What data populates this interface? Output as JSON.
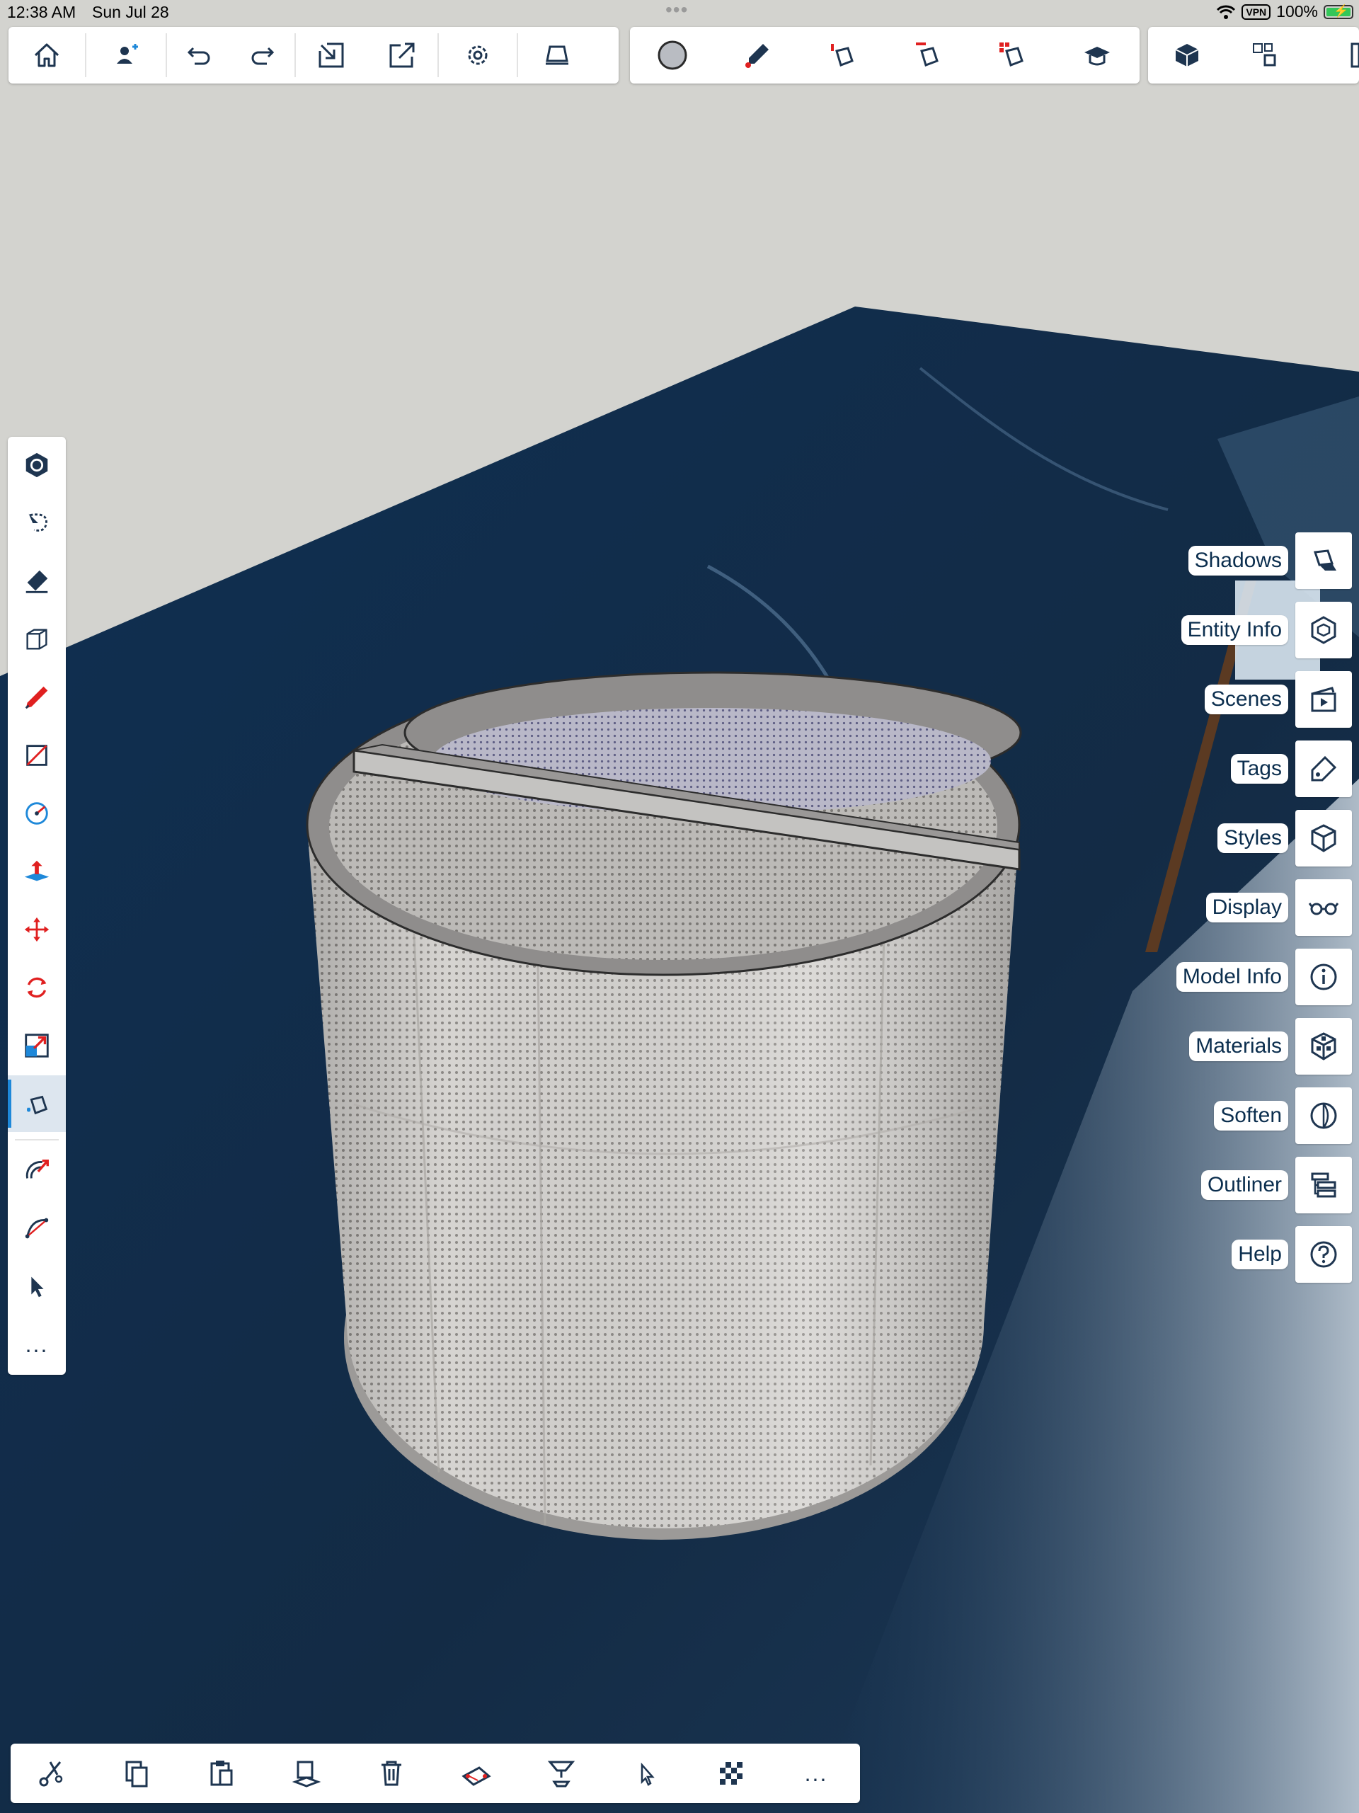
{
  "status_bar": {
    "time": "12:38 AM",
    "date": "Sun Jul 28",
    "multitask_dots": "•••",
    "vpn": "VPN",
    "battery": "100%"
  },
  "colors": {
    "accent": "#1e88d9",
    "icon_dark": "#1e3550",
    "icon_red": "#e02020",
    "label_text": "#0b2e4e",
    "sky": "#d3d3cf",
    "water": "#122e4c",
    "cylinder": "#cfcdca"
  },
  "top_toolbar": {
    "group1": [
      "home-icon",
      "add-user-icon",
      "undo-icon",
      "redo-icon",
      "import-icon",
      "export-icon",
      "settings-icon",
      "eraser-icon"
    ],
    "group2": [
      "material-swatch-icon",
      "eyedropper-icon",
      "paint-bucket-icon",
      "paint-adjacent-icon",
      "paint-connected-icon",
      "learn-icon"
    ],
    "group3": [
      "component-icon",
      "components-icon",
      "more-icon"
    ]
  },
  "left_toolbar": {
    "tools": [
      "tool-guide-icon",
      "lasso-select-icon",
      "eraser-icon",
      "push-pull-box-icon",
      "pencil-icon",
      "rectangle-icon",
      "circle-icon",
      "push-pull-icon",
      "move-icon",
      "rotate-icon",
      "scale-icon",
      "paint-bucket-icon",
      "follow-me-icon",
      "arc-icon",
      "select-icon",
      "more-icon"
    ],
    "active_tool": "paint-bucket-icon",
    "more_label": "..."
  },
  "right_panel": {
    "items": [
      {
        "label": "Shadows",
        "icon": "shadows-icon"
      },
      {
        "label": "Entity Info",
        "icon": "entity-info-icon"
      },
      {
        "label": "Scenes",
        "icon": "scenes-icon"
      },
      {
        "label": "Tags",
        "icon": "tags-icon"
      },
      {
        "label": "Styles",
        "icon": "styles-icon"
      },
      {
        "label": "Display",
        "icon": "display-icon"
      },
      {
        "label": "Model Info",
        "icon": "model-info-icon"
      },
      {
        "label": "Materials",
        "icon": "materials-icon"
      },
      {
        "label": "Soften",
        "icon": "soften-icon"
      },
      {
        "label": "Outliner",
        "icon": "outliner-icon"
      },
      {
        "label": "Help",
        "icon": "help-icon"
      }
    ]
  },
  "bottom_toolbar": {
    "items": [
      "cut-icon",
      "copy-icon",
      "paste-icon",
      "paste-in-place-icon",
      "delete-icon",
      "position-texture-icon",
      "section-plane-icon",
      "select-icon",
      "checker-icon",
      "more-icon"
    ],
    "more_label": "..."
  }
}
